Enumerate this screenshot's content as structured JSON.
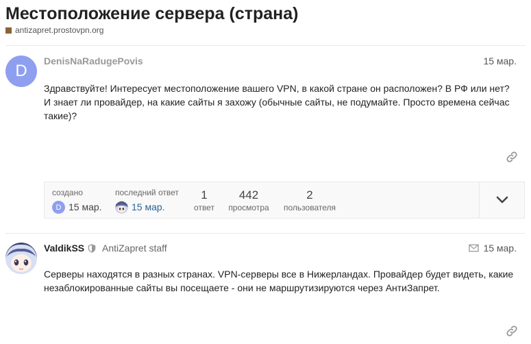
{
  "topic": {
    "title": "Местоположение сервера (страна)",
    "category": "antizapret.prostovpn.org",
    "category_color": "#8c6238"
  },
  "posts": [
    {
      "avatar_letter": "D",
      "avatar_color": "#8f9ff0",
      "username": "DenisNaRadugePovis",
      "date": "15 мар.",
      "body_lines": [
        "Здравствуйте! Интересует местоположение вашего VPN, в какой стране он расположен? В РФ или нет?",
        "И знает ли провайдер, на какие сайты я захожу (обычные сайты, не подумайте. Просто времена сейчас",
        "такие)?"
      ]
    },
    {
      "username": "ValdikSS",
      "title": "AntiZapret staff",
      "date": "15 мар.",
      "body_lines": [
        "Серверы находятся в разных странах. VPN-серверы все в Нижерландах. Провайдер будет видеть, какие",
        "незаблокированные сайты вы посещаете - они не маршрутизируются через АнтиЗапрет."
      ]
    }
  ],
  "topic_map": {
    "created_label": "создано",
    "created_date": "15 мар.",
    "created_avatar_letter": "D",
    "last_reply_label": "последний ответ",
    "last_reply_date": "15 мар.",
    "replies_count": "1",
    "replies_label": "ответ",
    "views_count": "442",
    "views_label": "просмотра",
    "users_count": "2",
    "users_label": "пользователя",
    "link_color": "#2a6496"
  }
}
